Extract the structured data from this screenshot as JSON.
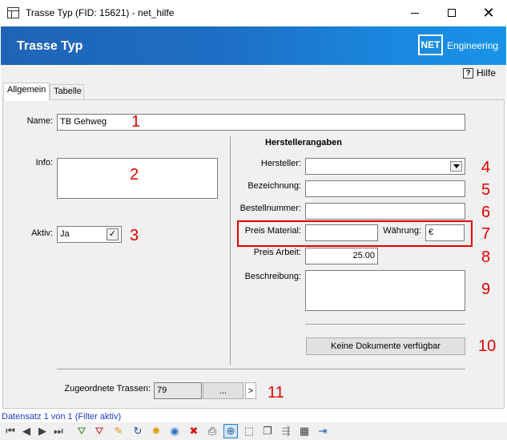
{
  "window": {
    "title": "Trasse Typ (FID: 15621) - net_hilfe",
    "minimize_glyph": "—",
    "close_glyph": "✕"
  },
  "banner": {
    "form_title": "Trasse Typ",
    "logo_mark": "NET",
    "logo_text": "Engineering"
  },
  "help": {
    "icon": "?",
    "label": "Hilfe"
  },
  "tabs": [
    {
      "label": "Allgemein",
      "active": true
    },
    {
      "label": "Tabelle",
      "active": false
    }
  ],
  "form": {
    "name_label": "Name:",
    "name_value": "TB Gehweg",
    "info_label": "Info:",
    "info_value": "",
    "aktiv_label": "Aktiv:",
    "aktiv_value": "Ja",
    "aktiv_check": "✓",
    "hersteller_section": "Herstellerangaben",
    "hersteller_label": "Hersteller:",
    "hersteller_value": "",
    "bezeichnung_label": "Bezeichnung:",
    "bezeichnung_value": "",
    "bestellnummer_label": "Bestellnummer:",
    "bestellnummer_value": "",
    "preis_material_label": "Preis Material:",
    "preis_material_value": "",
    "waehrung_label": "Währung:",
    "waehrung_value": "€",
    "preis_arbeit_label": "Preis Arbeit:",
    "preis_arbeit_value": "25.00",
    "beschreibung_label": "Beschreibung:",
    "beschreibung_value": "",
    "dokumente_button": "Keine Dokumente verfügbar",
    "zugeordnete_label": "Zugeordnete Trassen:",
    "zugeordnete_value": "79",
    "ellipsis_button": "...",
    "next_button": ">"
  },
  "annotations": [
    "1",
    "2",
    "3",
    "4",
    "5",
    "6",
    "7",
    "8",
    "9",
    "10",
    "11"
  ],
  "status": {
    "text": "Datensatz 1 von 1 (Filter aktiv)"
  },
  "navbar": {
    "icons": [
      {
        "name": "first-record-icon",
        "glyph": "⏮"
      },
      {
        "name": "previous-record-icon",
        "glyph": "◀"
      },
      {
        "name": "next-record-icon",
        "glyph": "▶"
      },
      {
        "name": "last-record-icon",
        "glyph": "⏭"
      },
      {
        "name": "filter-add-icon",
        "glyph": "⛛"
      },
      {
        "name": "filter-remove-icon",
        "glyph": "⛛"
      },
      {
        "name": "edit-pencil-icon",
        "glyph": "✎"
      },
      {
        "name": "refresh-icon",
        "glyph": "↻"
      },
      {
        "name": "new-record-icon",
        "glyph": "✹"
      },
      {
        "name": "globe-icon",
        "glyph": "◉"
      },
      {
        "name": "delete-icon",
        "glyph": "✖"
      },
      {
        "name": "print-icon",
        "glyph": "⎙"
      },
      {
        "name": "zoom-icon",
        "glyph": "⊕"
      },
      {
        "name": "select-icon",
        "glyph": "⬚"
      },
      {
        "name": "copy-icon",
        "glyph": "❐"
      },
      {
        "name": "link-icon",
        "glyph": "⇶"
      },
      {
        "name": "table-icon",
        "glyph": "▦"
      },
      {
        "name": "exit-icon",
        "glyph": "⇥"
      }
    ],
    "colors": {
      "first-record-icon": "#404040",
      "previous-record-icon": "#404040",
      "next-record-icon": "#404040",
      "last-record-icon": "#404040",
      "filter-add-icon": "#2a8a2a",
      "filter-remove-icon": "#d02020",
      "edit-pencil-icon": "#d89a20",
      "refresh-icon": "#2050a0",
      "new-record-icon": "#e0a000",
      "globe-icon": "#2070c0",
      "delete-icon": "#e01010",
      "print-icon": "#404040",
      "zoom-icon": "#306090",
      "select-icon": "#404040",
      "copy-icon": "#404040",
      "link-icon": "#808080",
      "table-icon": "#404040",
      "exit-icon": "#2060b0"
    }
  },
  "colors": {
    "banner_start": "#1f64b5",
    "banner_end": "#1893e8",
    "annotation_red": "#e00000",
    "status_blue": "#1a3cc8"
  }
}
